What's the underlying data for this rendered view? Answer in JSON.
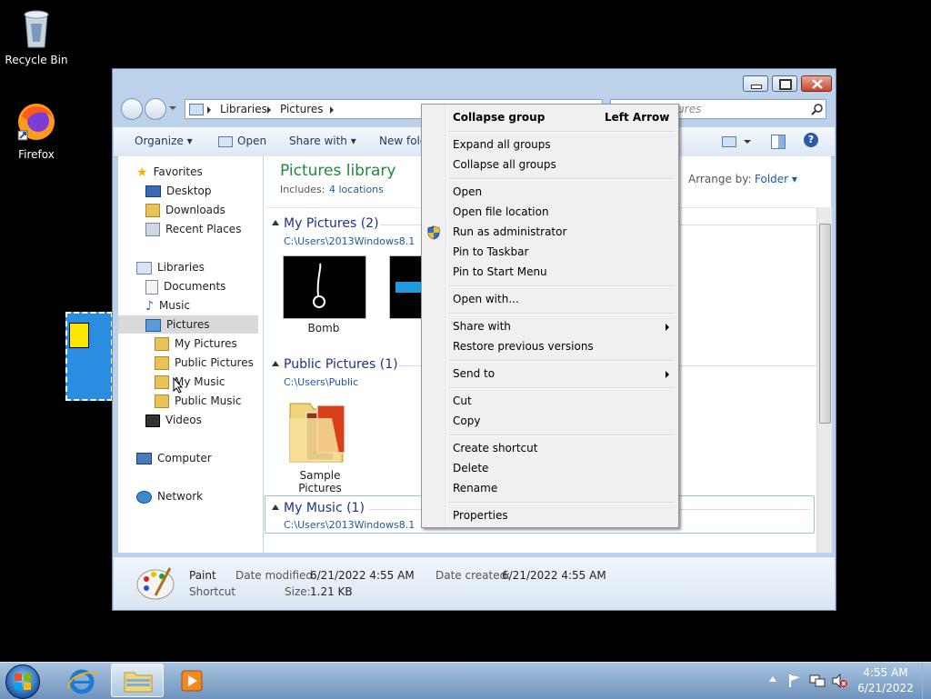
{
  "desktop": {
    "recycle_bin": "Recycle Bin",
    "firefox": "Firefox"
  },
  "window": {
    "address": {
      "crumb1": "Libraries",
      "crumb2": "Pictures"
    },
    "search_placeholder": "Search Pictures",
    "toolbar": {
      "organize": "Organize",
      "open": "Open",
      "share_with": "Share with",
      "new_folder": "New folder"
    },
    "nav": {
      "favorites": "Favorites",
      "desktop": "Desktop",
      "downloads": "Downloads",
      "recent_places": "Recent Places",
      "libraries": "Libraries",
      "documents": "Documents",
      "music": "Music",
      "pictures": "Pictures",
      "my_pictures": "My Pictures",
      "public_pictures": "Public Pictures",
      "my_music": "My Music",
      "public_music": "Public Music",
      "videos": "Videos",
      "computer": "Computer",
      "network": "Network"
    },
    "content": {
      "title": "Pictures library",
      "includes_label": "Includes:",
      "includes_link": "4 locations",
      "arrange_label": "Arrange by:",
      "arrange_value": "Folder",
      "groups": {
        "my_pictures": {
          "header": "My Pictures (2)",
          "path": "C:\\Users\\2013Windows8.1",
          "item1": "Bomb"
        },
        "public_pictures": {
          "header": "Public Pictures (1)",
          "path": "C:\\Users\\Public",
          "item1": "Sample Pictures"
        },
        "my_music": {
          "header": "My Music (1)",
          "path": "C:\\Users\\2013Windows8.1"
        }
      }
    },
    "status": {
      "name": "Paint",
      "type": "Shortcut",
      "date_modified_label": "Date modified:",
      "date_modified": "6/21/2022 4:55 AM",
      "date_created_label": "Date created:",
      "date_created": "6/21/2022 4:55 AM",
      "size_label": "Size:",
      "size": "1.21 KB"
    }
  },
  "context_menu": {
    "collapse_group": "Collapse group",
    "collapse_group_shortcut": "Left Arrow",
    "expand_all": "Expand all groups",
    "collapse_all": "Collapse all groups",
    "open": "Open",
    "open_file_location": "Open file location",
    "run_as_admin": "Run as administrator",
    "pin_taskbar": "Pin to Taskbar",
    "pin_start": "Pin to Start Menu",
    "open_with": "Open with...",
    "share_with": "Share with",
    "restore": "Restore previous versions",
    "send_to": "Send to",
    "cut": "Cut",
    "copy": "Copy",
    "create_shortcut": "Create shortcut",
    "delete": "Delete",
    "rename": "Rename",
    "properties": "Properties"
  },
  "taskbar": {
    "time": "4:55 AM",
    "date": "6/21/2022"
  }
}
